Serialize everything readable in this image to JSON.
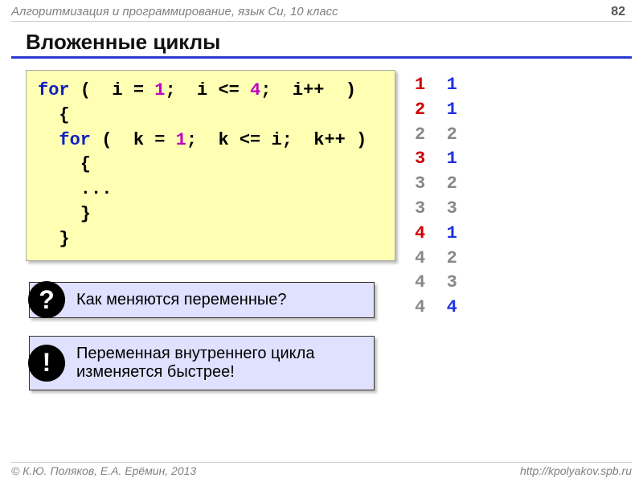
{
  "header": {
    "course": "Алгоритмизация и программирование, язык Си, 10 класс",
    "page": "82"
  },
  "title": "Вложенные циклы",
  "code": {
    "kw_for1": "for",
    "l1a": " (  i = ",
    "n1": "1",
    "l1b": ";  i <= ",
    "n4": "4",
    "l1c": ";  i++  )",
    "l2": "  {",
    "kw_for2": "for",
    "l3a": " (  k = ",
    "n1b": "1",
    "l3b": ";  k <= i;  k++ )",
    "l4": "    {",
    "l5": "    ...",
    "l6": "    }",
    "l7": "  }"
  },
  "callouts": {
    "q_badge": "?",
    "q_text": "Как меняются переменные?",
    "e_badge": "!",
    "e_text": "Переменная внутреннего цикла изменяется быстрее!"
  },
  "trace": [
    {
      "i": "1",
      "k": "1",
      "iNew": true,
      "kNew": true
    },
    {
      "i": "2",
      "k": "1",
      "iNew": true,
      "kNew": true
    },
    {
      "i": "2",
      "k": "2",
      "iNew": false,
      "kNew": false
    },
    {
      "i": "3",
      "k": "1",
      "iNew": true,
      "kNew": true
    },
    {
      "i": "3",
      "k": "2",
      "iNew": false,
      "kNew": false
    },
    {
      "i": "3",
      "k": "3",
      "iNew": false,
      "kNew": false
    },
    {
      "i": "4",
      "k": "1",
      "iNew": true,
      "kNew": true
    },
    {
      "i": "4",
      "k": "2",
      "iNew": false,
      "kNew": false
    },
    {
      "i": "4",
      "k": "3",
      "iNew": false,
      "kNew": false
    },
    {
      "i": "4",
      "k": "4",
      "iNew": false,
      "kNew": true
    }
  ],
  "footer": {
    "authors": "К.Ю. Поляков, Е.А. Ерёмин, 2013",
    "url": "http://kpolyakov.spb.ru"
  }
}
